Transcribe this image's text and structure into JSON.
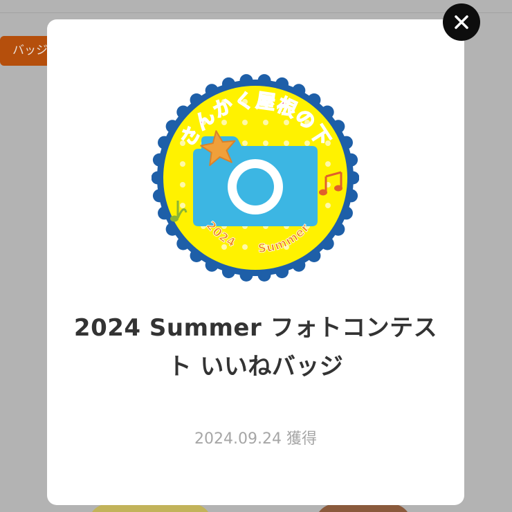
{
  "background": {
    "tab_label": "バッジ"
  },
  "modal": {
    "badge": {
      "arc_text": "さんかく屋根の下",
      "year_text": "2024",
      "season_text": "Summer",
      "rim_color": "#1e5fa8",
      "face_color": "#fff200",
      "camera_color": "#3cb6e3",
      "arc_text_color": "#e94c8c",
      "bottom_text_color": "#f08a20"
    },
    "title": "2024 Summer フォトコンテスト いいねバッジ",
    "acquired_date": "2024.09.24",
    "acquired_suffix": "獲得",
    "close_icon": "close-icon"
  }
}
